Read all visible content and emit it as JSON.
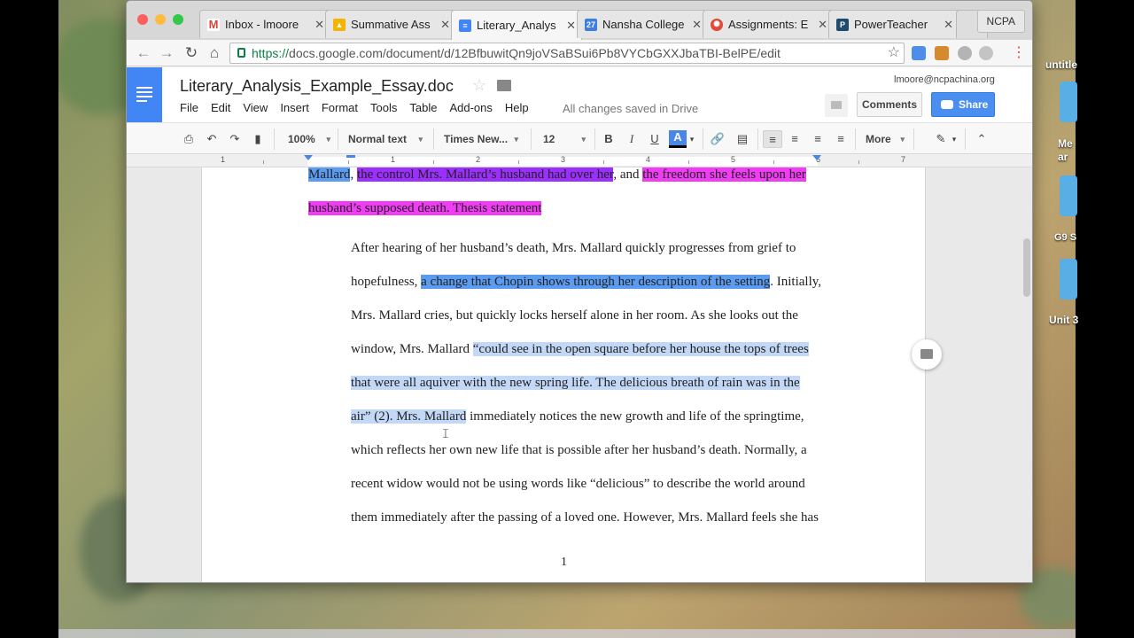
{
  "browser": {
    "tabs": [
      {
        "title": "Inbox - lmoore",
        "icon": "gmail-icon",
        "color": "#d44638"
      },
      {
        "title": "Summative Ass",
        "icon": "drive-icon",
        "color": "#f4b400"
      },
      {
        "title": "Literary_Analys",
        "icon": "docs-icon",
        "color": "#4285f4"
      },
      {
        "title": "Nansha College",
        "icon": "calendar-icon",
        "color": "#3d7ee0"
      },
      {
        "title": "Assignments: E",
        "icon": "canvas-icon",
        "color": "#e04a3d"
      },
      {
        "title": "PowerTeacher",
        "icon": "powerteacher-icon",
        "color": "#1e4b6e"
      }
    ],
    "profile": "NCPA",
    "url_scheme": "https://",
    "url_rest": "docs.google.com/document/d/12BfbuwitQn9joVSaBSui6Pb8VYCbGXXJbaTBI-BelPE/edit"
  },
  "docs": {
    "title": "Literary_Analysis_Example_Essay.doc",
    "account": "lmoore@ncpachina.org",
    "menu": [
      "File",
      "Edit",
      "View",
      "Insert",
      "Format",
      "Tools",
      "Table",
      "Add-ons",
      "Help"
    ],
    "saved_status": "All changes saved in Drive",
    "comments_label": "Comments",
    "share_label": "Share"
  },
  "toolbar": {
    "zoom": "100%",
    "style": "Normal text",
    "font": "Times New...",
    "size": "12",
    "bold": "B",
    "italic": "I",
    "underline": "U",
    "text_color": "A",
    "more": "More"
  },
  "ruler": {
    "numbers": [
      "1",
      "1",
      "2",
      "3",
      "4",
      "5",
      "6",
      "7"
    ]
  },
  "document": {
    "p1_s1": "Mallard",
    "p1_s2": ", ",
    "p1_s3": "the control Mrs. Mallard’s husband had over her",
    "p1_s4": ", and ",
    "p1_s5": "the freedom she feels upon her husband’s supposed death. Thesis statement",
    "p2_s1": "After hearing of her husband’s death, Mrs. Mallard quickly progresses from grief to hopefulness, ",
    "p2_s2": "a change that Chopin shows through her description of the setting",
    "p2_s3": ". Initially, Mrs. Mallard cries, but quickly locks herself alone in her room. As she looks out the window, Mrs. Mallard ",
    "p2_s4": "“could see in the open square before her house the tops of trees that were all aquiver with the new spring life. The delicious breath of rain was in the air” (2). Mrs. Mallard",
    "p2_s5": " immediately notices the new growth and life of the springtime, which reflects her own new life that is possible after her husband’s death. Normally, a recent widow would not be using words like “delicious” to describe the world around them immediately after the passing of a loved one. However, Mrs. Mallard feels she has",
    "page_number": "1"
  },
  "desktop": {
    "labels": [
      "untitle",
      "Me ar",
      "G9 S",
      "Unit 3"
    ]
  }
}
